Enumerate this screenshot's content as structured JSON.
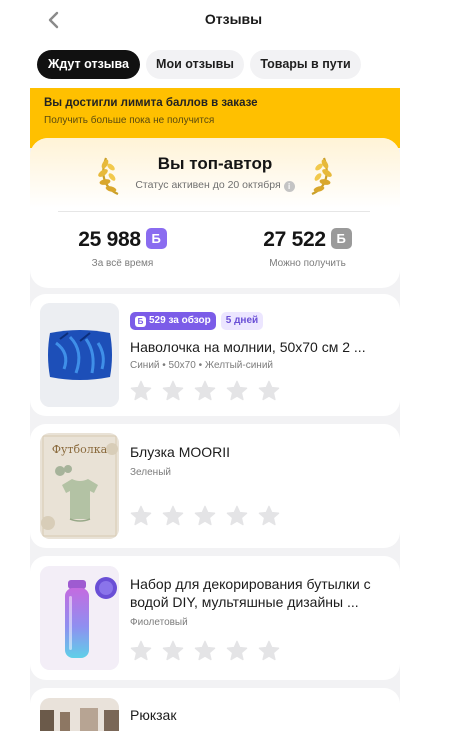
{
  "header": {
    "title": "Отзывы",
    "back_icon": "chevron-left-icon"
  },
  "tabs": [
    {
      "label": "Ждут отзыва",
      "active": true
    },
    {
      "label": "Мои отзывы",
      "active": false
    },
    {
      "label": "Товары в пути",
      "active": false
    }
  ],
  "limit_banner": {
    "title": "Вы достигли лимита баллов в заказе",
    "subtitle": "Получить больше пока не получится",
    "color": "#ffc000"
  },
  "author": {
    "title": "Вы топ-автор",
    "status": "Статус активен до 20 октября",
    "info_icon": "info-icon",
    "total_value": "25 988",
    "total_label": "За всё время",
    "available_value": "27 522",
    "available_label": "Можно получить",
    "points_badge": "Б"
  },
  "products": [
    {
      "points_chip": "529 за обзор",
      "days_chip": "5 дней",
      "title": "Наволочка на молнии, 50х70 см 2 ...",
      "attributes": "Синий • 50х70 • Желтый-синий",
      "rating": 0
    },
    {
      "title": "Блузка MOORII",
      "attributes": "Зеленый",
      "thumb_text": "Футболка",
      "rating": 0
    },
    {
      "title": "Набор для декорирования бутылки с водой DIY, мультяшные дизайны ...",
      "attributes": "Фиолетовый",
      "rating": 0
    },
    {
      "title": "Рюкзак"
    }
  ],
  "colors": {
    "accent": "#7b5ce8",
    "star": "#e4e4e6",
    "active_tab": "#111111"
  }
}
